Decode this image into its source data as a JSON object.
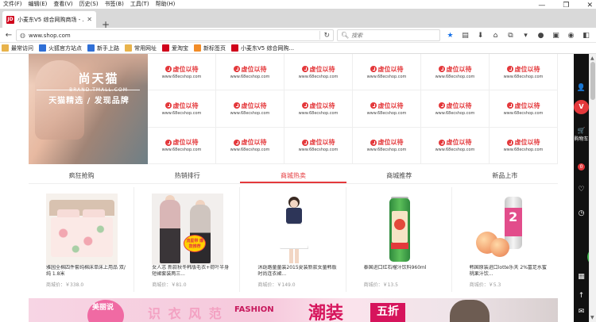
{
  "browser": {
    "menu": [
      "文件(F)",
      "编辑(E)",
      "查看(V)",
      "历史(S)",
      "书签(B)",
      "工具(T)",
      "帮助(H)"
    ],
    "window_controls": [
      "—",
      "❐",
      "✕"
    ],
    "tab": {
      "favicon": "JD",
      "title": "小麦东V5 综合网购商场 - ...",
      "close": "✕"
    },
    "new_tab": "+",
    "url": "www.shop.com",
    "search_placeholder": "搜索",
    "bookmarks": [
      {
        "label": "最常访问",
        "icon": "folder"
      },
      {
        "label": "火狐官方站点",
        "icon": "blue"
      },
      {
        "label": "新手上路",
        "icon": "blue"
      },
      {
        "label": "常用网址",
        "icon": "folder"
      },
      {
        "label": "爱淘宝",
        "icon": "red"
      },
      {
        "label": "新标签页",
        "icon": "orange"
      },
      {
        "label": "小麦东V5 综合网购...",
        "icon": "red"
      }
    ]
  },
  "banner": {
    "brand_cn": "尚天猫",
    "brand_en": "BRAND.TMALL.COM",
    "tagline": "天猫精选 / 发现品牌"
  },
  "logo_grid": {
    "text": "虚位以待",
    "url": "www.68ecshop.com",
    "count": 18
  },
  "tabs": [
    {
      "label": "疯狂抢购",
      "active": false
    },
    {
      "label": "热销排行",
      "active": false
    },
    {
      "label": "商城热卖",
      "active": true
    },
    {
      "label": "商城推荐",
      "active": false
    },
    {
      "label": "新品上市",
      "active": false
    }
  ],
  "products": [
    {
      "name": "雅园全棉四件套纯棉床单床上用品 双/纯 1.8米",
      "price": "商城价：￥338.0",
      "art": "bed"
    },
    {
      "name": "女人志 新款秋冬韩版毛衣+荷叶半身短裙套装两三...",
      "price": "商城价：￥81.0",
      "badge": "流星带 爆款推荐",
      "art": "coat"
    },
    {
      "name": "沐跶路童童装2015夏装新款女童韩版时尚连衣裙...",
      "price": "商城价：￥149.0",
      "art": "girl"
    },
    {
      "name": "泰国进口红石榴汁饮料960ml",
      "price": "商城价：￥13.5",
      "art": "can"
    },
    {
      "name": "韩国原装进口lotte乐天 2%富足水蜜桃果汁饮...",
      "price": "商城价：￥5.3",
      "bottle_number": "2",
      "art": "peach"
    }
  ],
  "promo": {
    "circle_text": "美丽说",
    "headline": "识 衣 风 范",
    "fashion": "FASHION",
    "big": "潮装",
    "discount": "五折"
  },
  "sidebar": {
    "user_icon": "👤",
    "vip": "V",
    "cart_icon": "🛒",
    "cart_label": "购物车",
    "cart_count": "0",
    "fav_icon": "♡",
    "clock_icon": "◷",
    "qr_icon": "▦",
    "top_icon": "↑",
    "feedback_icon": "✉"
  },
  "float_button": "←"
}
